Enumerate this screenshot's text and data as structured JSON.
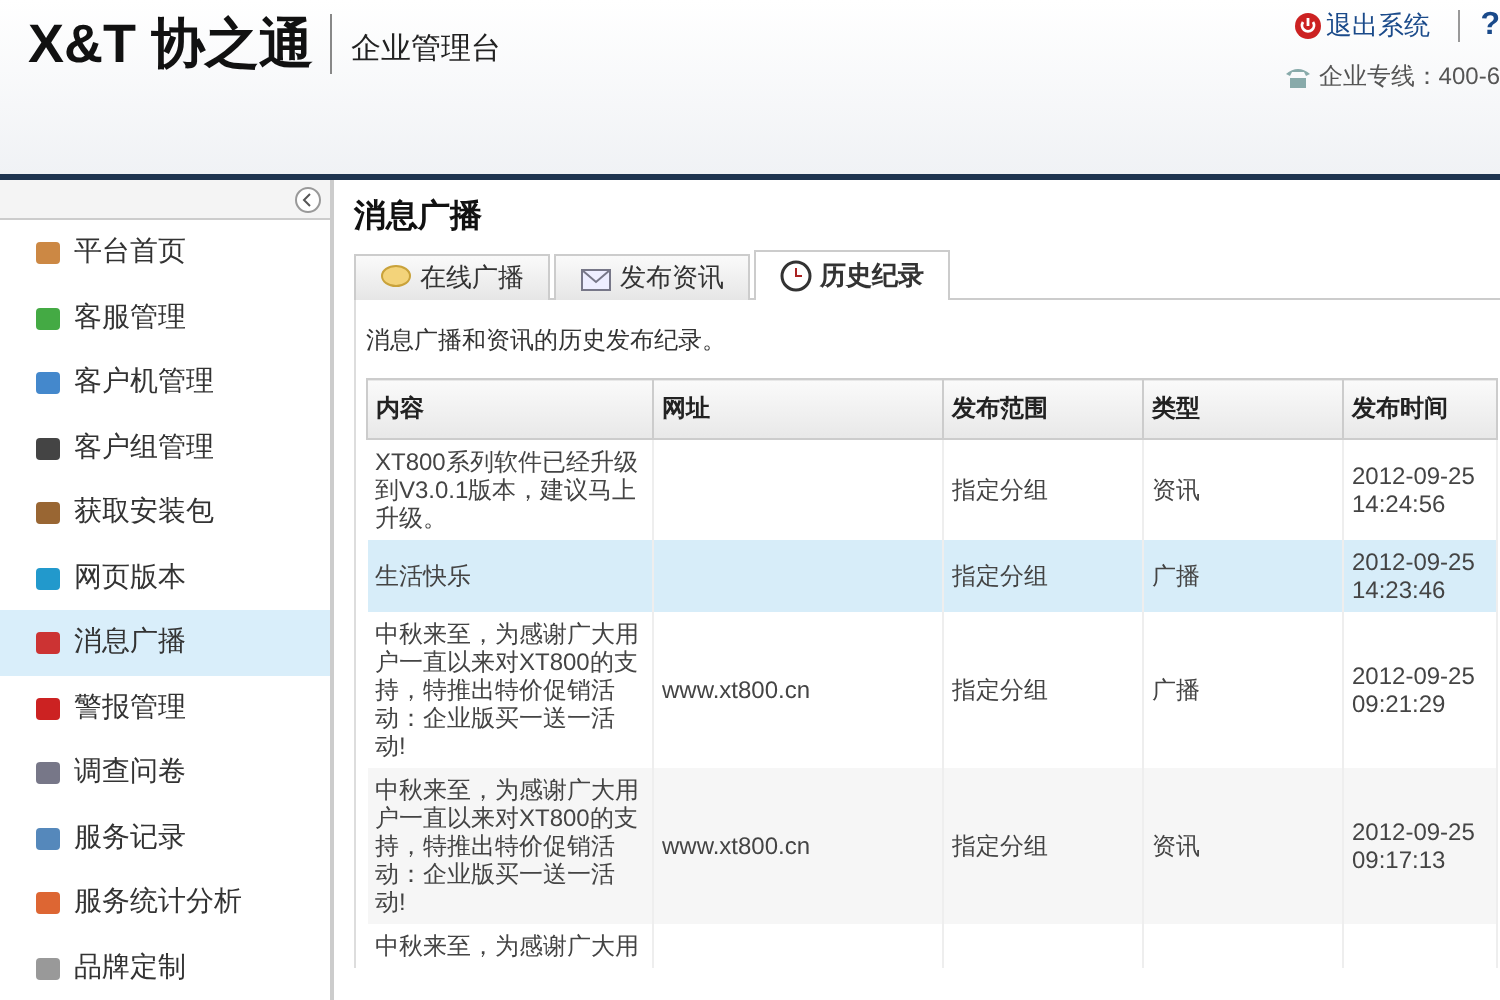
{
  "header": {
    "logo": "X&T 协之通",
    "subtitle": "企业管理台",
    "logout": "退出系统",
    "help": "?",
    "hotline": "企业专线：400-6"
  },
  "sidebar": {
    "items": [
      {
        "label": "平台首页",
        "selected": false
      },
      {
        "label": "客服管理",
        "selected": false
      },
      {
        "label": "客户机管理",
        "selected": false
      },
      {
        "label": "客户组管理",
        "selected": false
      },
      {
        "label": "获取安装包",
        "selected": false
      },
      {
        "label": "网页版本",
        "selected": false
      },
      {
        "label": "消息广播",
        "selected": true
      },
      {
        "label": "警报管理",
        "selected": false
      },
      {
        "label": "调查问卷",
        "selected": false
      },
      {
        "label": "服务记录",
        "selected": false
      },
      {
        "label": "服务统计分析",
        "selected": false
      },
      {
        "label": "品牌定制",
        "selected": false
      }
    ]
  },
  "page": {
    "title": "消息广播",
    "tabs": [
      {
        "label": "在线广播",
        "selected": false
      },
      {
        "label": "发布资讯",
        "selected": false
      },
      {
        "label": "历史纪录",
        "selected": true
      }
    ],
    "description": "消息广播和资讯的历史发布纪录。"
  },
  "table": {
    "columns": [
      "内容",
      "网址",
      "发布范围",
      "类型",
      "发布时间"
    ],
    "rows": [
      {
        "selected": false,
        "cells": [
          "XT800系列软件已经升级到V3.0.1版本，建议马上升级。",
          "",
          "指定分组",
          "资讯",
          "2012-09-25 14:24:56"
        ]
      },
      {
        "selected": true,
        "cells": [
          "生活快乐",
          "",
          "指定分组",
          "广播",
          "2012-09-25 14:23:46"
        ]
      },
      {
        "selected": false,
        "cells": [
          "中秋来至，为感谢广大用户一直以来对XT800的支持，特推出特价促销活动：企业版买一送一活动!",
          "www.xt800.cn",
          "指定分组",
          "广播",
          "2012-09-25 09:21:29"
        ]
      },
      {
        "selected": false,
        "cells": [
          "中秋来至，为感谢广大用户一直以来对XT800的支持，特推出特价促销活动：企业版买一送一活动!",
          "www.xt800.cn",
          "指定分组",
          "资讯",
          "2012-09-25 09:17:13"
        ]
      },
      {
        "selected": false,
        "cells": [
          "中秋来至，为感谢广大用",
          "",
          "",
          "",
          ""
        ]
      }
    ]
  }
}
